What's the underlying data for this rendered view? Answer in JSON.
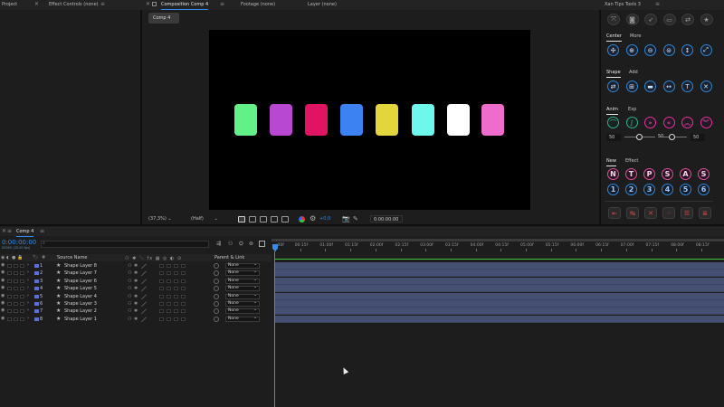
{
  "top_tabs": {
    "project": "Project",
    "effect_controls": "Effect Controls (none)",
    "composition": "Composition Comp 4",
    "footage": "Footage (none)",
    "layer": "Layer (none)",
    "tools_panel": "Xan Tips Tools 3"
  },
  "comp_viewer": {
    "comp_button": "Comp 4",
    "swatch_colors": [
      "#63f088",
      "#b848cf",
      "#e01462",
      "#3d82f2",
      "#e2d63c",
      "#6ef8ec",
      "#ffffff",
      "#ee6ccc"
    ],
    "zoom": "(37,3%)",
    "resolution": "(Half)",
    "exposure": "+0,0",
    "timecode": "0:00:00:00",
    "accent_color": "#2d8ceb"
  },
  "timeline": {
    "tab": "Comp 4",
    "timecode": "0:00:00:00",
    "timecode_sub": "00000 (25.00 fps)",
    "search_placeholder": "",
    "col_hash": "#",
    "col_source_name": "Source Name",
    "col_parent_link": "Parent & Link",
    "ruler_labels": [
      ":00f",
      "00:15f",
      "01:00f",
      "01:15f",
      "02:00f",
      "02:15f",
      "03:00f",
      "03:15f",
      "04:00f",
      "04:15f",
      "05:00f",
      "05:15f",
      "06:00f",
      "06:15f",
      "07:00f",
      "07:15f",
      "08:00f",
      "08:15f"
    ],
    "layers": [
      {
        "num": "1",
        "name": "Shape Layer 8",
        "parent": "None"
      },
      {
        "num": "2",
        "name": "Shape Layer 7",
        "parent": "None"
      },
      {
        "num": "3",
        "name": "Shape Layer 6",
        "parent": "None"
      },
      {
        "num": "4",
        "name": "Shape Layer 5",
        "parent": "None"
      },
      {
        "num": "5",
        "name": "Shape Layer 4",
        "parent": "None"
      },
      {
        "num": "6",
        "name": "Shape Layer 3",
        "parent": "None"
      },
      {
        "num": "7",
        "name": "Shape Layer 2",
        "parent": "None"
      },
      {
        "num": "8",
        "name": "Shape Layer 1",
        "parent": "None"
      }
    ]
  },
  "tools": {
    "tab_center": "Center",
    "tab_more": "More",
    "tab_shape": "Shape",
    "tab_add": "Add",
    "tab_anim": "Anim",
    "tab_exp": "Exp",
    "slider1_value": "50",
    "slider2_value": "50",
    "slider3_value": "50",
    "tab_new": "New",
    "tab_effect": "Effect",
    "letters_row": [
      "N",
      "T",
      "P",
      "S",
      "A",
      "S"
    ],
    "numbers_row": [
      "1",
      "2",
      "3",
      "4",
      "5",
      "6"
    ]
  }
}
